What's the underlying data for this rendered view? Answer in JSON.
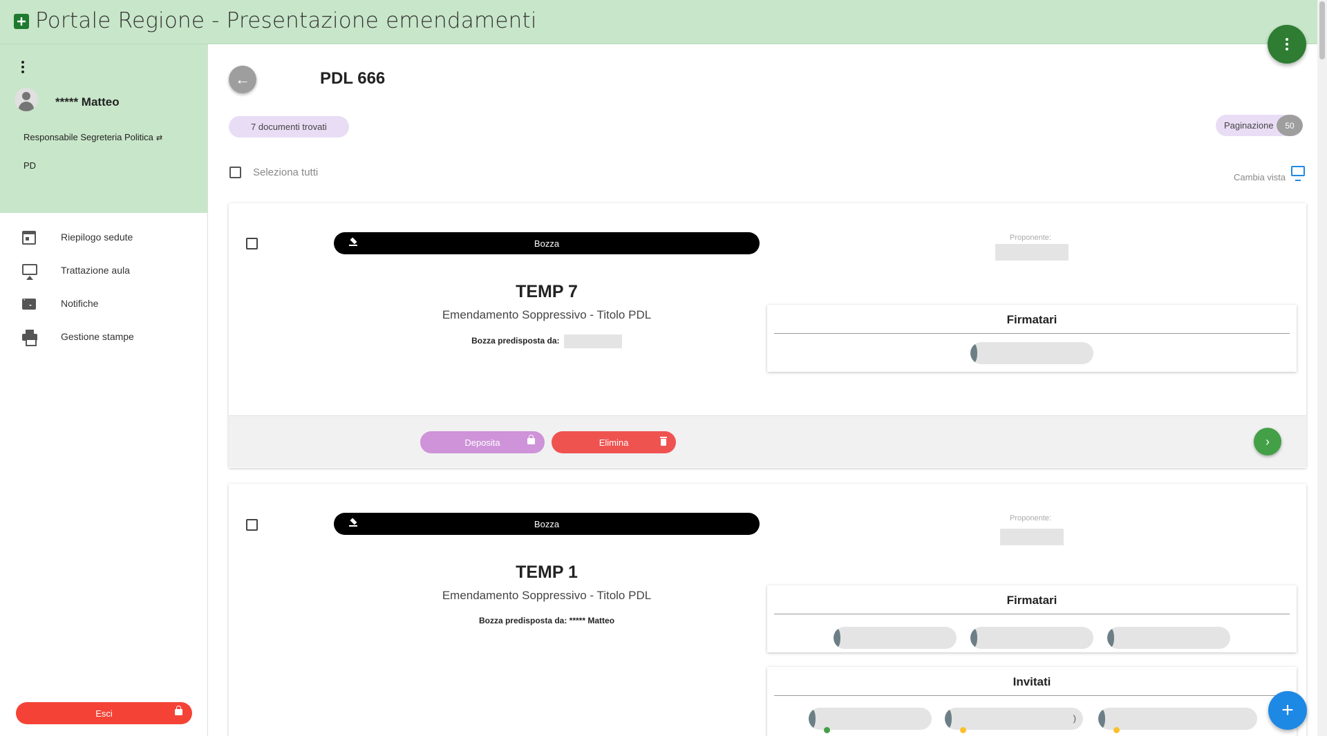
{
  "app": {
    "title": "Portale Regione - Presentazione emendamenti"
  },
  "user": {
    "name": "***** Matteo",
    "role": "Responsabile Segreteria Politica",
    "group": "PD"
  },
  "nav": [
    {
      "label": "Riepilogo sedute",
      "icon": "calendar-icon"
    },
    {
      "label": "Trattazione aula",
      "icon": "cast-screen-icon"
    },
    {
      "label": "Notifiche",
      "icon": "mail-icon"
    },
    {
      "label": "Gestione stampe",
      "icon": "printer-icon"
    }
  ],
  "logout_label": "Esci",
  "page": {
    "title": "PDL 666",
    "results_count": "7 documenti trovati",
    "pagination_label": "Paginazione",
    "pagination_value": "50",
    "select_all_label": "Seleziona tutti",
    "view_label": "Cambia vista"
  },
  "cards": [
    {
      "status": "Bozza",
      "title": "TEMP 7",
      "subtitle": "Emendamento Soppressivo - Titolo PDL",
      "draft_label": "Bozza predisposta da:",
      "draft_author": "",
      "proponent_label": "Proponente:",
      "signers_label": "Firmatari",
      "deposit_label": "Deposita",
      "delete_label": "Elimina"
    },
    {
      "status": "Bozza",
      "title": "TEMP 1",
      "subtitle": "Emendamento Soppressivo - Titolo PDL",
      "draft_label": "Bozza predisposta da:",
      "draft_author": "***** Matteo",
      "proponent_label": "Proponente:",
      "signers_label": "Firmatari",
      "invited_label": "Invitati",
      "invited_paren": ")"
    }
  ],
  "colors": {
    "header_bg": "#c8e6c9",
    "primary_green": "#2e7d32",
    "fab_blue": "#1e88e5",
    "deposit": "#ce93d8",
    "delete": "#ef5350"
  }
}
